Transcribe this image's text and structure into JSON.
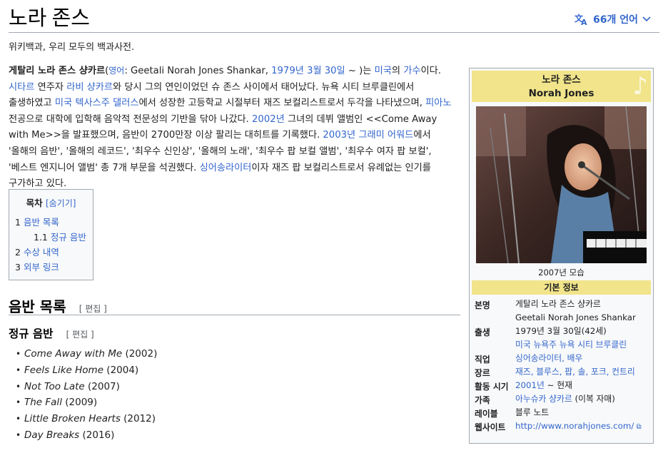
{
  "header": {
    "title": "노라 존스",
    "languages_label": "66개 언어"
  },
  "tagline": "위키백과, 우리 모두의 백과사전.",
  "lead": {
    "segments": [
      {
        "t": "게탈리 노라 존스 샹카르",
        "b": true
      },
      {
        "t": "(",
        "b": false
      },
      {
        "t": "영어",
        "link": true,
        "small": true
      },
      {
        "t": ": Geetali Norah Jones Shankar, "
      },
      {
        "t": "1979년",
        "link": true
      },
      {
        "t": " "
      },
      {
        "t": "3월 30일",
        "link": true
      },
      {
        "t": " ~ )는 "
      },
      {
        "t": "미국",
        "link": true
      },
      {
        "t": "의 "
      },
      {
        "t": "가수",
        "link": true
      },
      {
        "t": "이다. "
      },
      {
        "t": "시타르",
        "link": true
      },
      {
        "t": " 연주자 "
      },
      {
        "t": "라비 샹카르",
        "link": true
      },
      {
        "t": "와 당시 그의 연인이었던 슈 존스 사이에서 태어났다. 뉴욕 시티 브루클린에서 출생하였고 "
      },
      {
        "t": "미국",
        "link": true
      },
      {
        "t": " "
      },
      {
        "t": "텍사스주",
        "link": true
      },
      {
        "t": " "
      },
      {
        "t": "댈러스",
        "link": true
      },
      {
        "t": "에서 성장한 고등학교 시절부터 재즈 보컬리스트로서 두각을 나타냈으며, "
      },
      {
        "t": "피아노",
        "link": true
      },
      {
        "t": " 전공으로 대학에 입학해 음악적 전문성의 기반을 닦아 나갔다. "
      },
      {
        "t": "2002년",
        "link": true
      },
      {
        "t": " 그녀의 데뷔 앨범인 <<Come Away with Me>>을 발표했으며, 음반이 2700만장 이상 팔리는 대히트를 기록했다. "
      },
      {
        "t": "2003년",
        "link": true
      },
      {
        "t": " "
      },
      {
        "t": "그래미 어워드",
        "link": true
      },
      {
        "t": "에서 '올해의 음반', '올해의 레코드', '최우수 신인상', '올해의 노래', '최우수 팝 보컬 앨범', '최우수 여자 팝 보컬', '베스트 엔지니어 앨범' 총 7개 부문을 석권했다. "
      },
      {
        "t": "싱어송라이터",
        "link": true
      },
      {
        "t": "이자 재즈 팝 보컬리스트로서 유례없는 인기를 구가하고 있다."
      }
    ]
  },
  "toc": {
    "title": "목차",
    "toggle": "[숨기기]",
    "items": [
      {
        "num": "1",
        "label": "음반 목록",
        "sub": false
      },
      {
        "num": "1.1",
        "label": "정규 음반",
        "sub": true
      },
      {
        "num": "2",
        "label": "수상 내역",
        "sub": false
      },
      {
        "num": "3",
        "label": "외부 링크",
        "sub": false
      }
    ]
  },
  "sections": {
    "discography": {
      "title": "음반 목록",
      "edit": "[ 편집 ]"
    },
    "studio": {
      "title": "정규 음반",
      "edit": "[ 편집 ]"
    }
  },
  "albums": [
    {
      "title": "Come Away with Me",
      "year": "(2002)"
    },
    {
      "title": "Feels Like Home",
      "year": "(2004)"
    },
    {
      "title": "Not Too Late",
      "year": "(2007)"
    },
    {
      "title": "The Fall",
      "year": "(2009)"
    },
    {
      "title": "Little Broken Hearts",
      "year": "(2012)"
    },
    {
      "title": "Day Breaks",
      "year": "(2016)"
    }
  ],
  "infobox": {
    "name_ko": "노라 존스",
    "name_en": "Norah Jones",
    "caption": "2007년 모습",
    "section_title": "기본 정보",
    "rows": [
      {
        "label": "본명",
        "lines": [
          {
            "t": "게탈리 노라 존스 샹카르"
          },
          {
            "t": "Geetali Norah Jones Shankar"
          }
        ]
      },
      {
        "label": "출생",
        "lines": [
          {
            "t": "1979년 3월 30일(42세)"
          },
          {
            "t": "미국 뉴욕주 뉴욕 시티 브루클린",
            "link": true
          }
        ]
      },
      {
        "label": "직업",
        "lines": [
          {
            "t": "싱어송라이터, 배우",
            "link": true
          }
        ]
      },
      {
        "label": "장르",
        "lines": [
          {
            "t": "재즈, 블루스, 팝, 솔, 포크, 컨트리",
            "link": true
          }
        ]
      },
      {
        "label": "활동 시기",
        "lines": [
          {
            "parts": [
              {
                "t": "2001년",
                "link": true
              },
              {
                "t": " ~ 현재"
              }
            ]
          }
        ]
      },
      {
        "label": "가족",
        "lines": [
          {
            "parts": [
              {
                "t": "아누슈카 샹카르",
                "link": true
              },
              {
                "t": " (이복 자매)"
              }
            ]
          }
        ]
      },
      {
        "label": "레이블",
        "lines": [
          {
            "t": "블루 노트"
          }
        ]
      },
      {
        "label": "웹사이트",
        "lines": [
          {
            "t": "http://www.norahjones.com/",
            "link": true,
            "ext": true
          }
        ]
      }
    ]
  },
  "colors": {
    "link": "#3366cc",
    "infobox_header": "#f1e48a",
    "border": "#a2a9b1"
  }
}
